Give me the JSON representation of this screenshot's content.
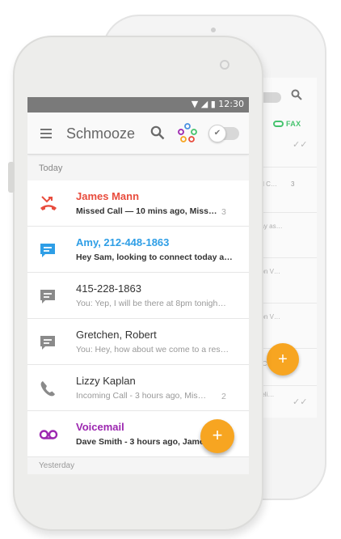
{
  "status_bar": {
    "time": "12:30"
  },
  "app": {
    "title": "Schmooze"
  },
  "sections": {
    "today": "Today",
    "yesterday": "Yesterday"
  },
  "conversations": [
    {
      "name": "James Mann",
      "preview": "Missed Call — 10 mins ago,  Miss…",
      "count": "3",
      "name_color": "#e84c3d",
      "icon": "missed-call-icon",
      "unread": true
    },
    {
      "name": "Amy, 212-448-1863",
      "preview": "Hey Sam, looking to connect today a…",
      "count": "",
      "name_color": "#2e9ee6",
      "icon": "message-icon",
      "unread": true
    },
    {
      "name": "415-228-1863",
      "preview": "You: Yep, I will be there at 8pm tonigh…",
      "count": "",
      "name_color": "#333333",
      "icon": "message-icon",
      "unread": false
    },
    {
      "name": "Gretchen, Robert",
      "preview": "You: Hey, how about we come to a res…",
      "count": "",
      "name_color": "#333333",
      "icon": "message-icon",
      "unread": false
    },
    {
      "name": "Lizzy Kaplan",
      "preview": "Incoming Call - 3 hours ago,  Mis…",
      "count": "2",
      "name_color": "#333333",
      "icon": "phone-icon",
      "unread": false
    },
    {
      "name": "Voicemail",
      "preview": "Dave Smith - 3 hours ago, Jame…",
      "count": "",
      "name_color": "#9c27b0",
      "icon": "voicemail-icon",
      "unread": true
    }
  ],
  "fab_label": "+",
  "back_screen": {
    "fax_label": "FAX",
    "rows": [
      {
        "text": "ed C…",
        "count": "3"
      },
      {
        "text": "day as…",
        "count": ""
      },
      {
        "text": "oon V…",
        "count": ""
      },
      {
        "text": "oon V…",
        "count": ""
      },
      {
        "text": "e C…",
        "count": "2"
      },
      {
        "text": "Beli…",
        "count": ""
      }
    ],
    "fab_label": "+"
  },
  "colors": {
    "accent": "#f7a521",
    "status_bar": "#7a7a7a",
    "missed": "#e84c3d",
    "unread_message": "#2e9ee6",
    "voicemail": "#9c27b0",
    "fax": "#46c36e"
  }
}
